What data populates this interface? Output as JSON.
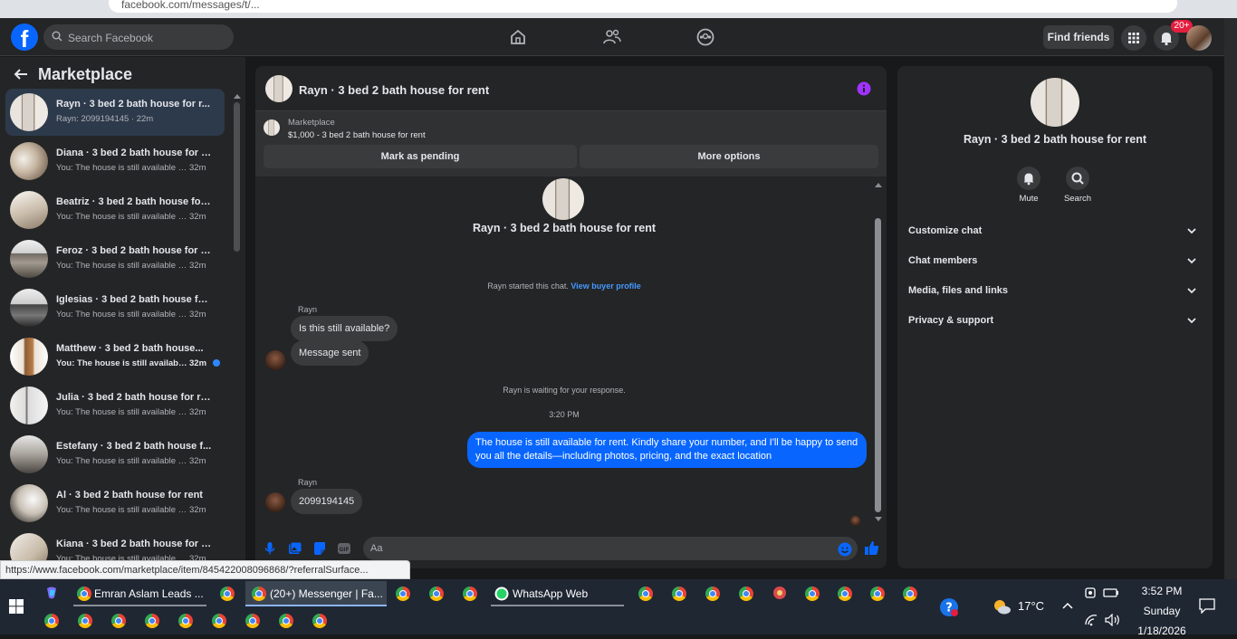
{
  "browser": {
    "url_fragment": "facebook.com/messages/t/..."
  },
  "topnav": {
    "search_placeholder": "Search Facebook",
    "find_friends": "Find friends",
    "notif_badge": "20+"
  },
  "sidebar": {
    "title": "Marketplace",
    "conversations": [
      {
        "name": "Rayn · 3 bed 2 bath house for r...",
        "preview": "Rayn: 2099194145 · 22m",
        "time": "",
        "active": true
      },
      {
        "name": "Diana · 3 bed 2 bath house for r...",
        "preview": "You: The house is still available f...",
        "time": "32m"
      },
      {
        "name": "Beatriz · 3 bed 2 bath house for...",
        "preview": "You: The house is still available f...",
        "time": "32m"
      },
      {
        "name": "Feroz · 3 bed 2 bath house for r...",
        "preview": "You: The house is still available f...",
        "time": "32m"
      },
      {
        "name": "Iglesias · 3 bed 2 bath house fo...",
        "preview": "You: The house is still available f...",
        "time": "32m"
      },
      {
        "name": "Matthew · 3 bed 2 bath house...",
        "preview": "You: The house is still availabl...",
        "time": "32m",
        "unread": true
      },
      {
        "name": "Julia · 3 bed 2 bath house for re...",
        "preview": "You: The house is still available f...",
        "time": "32m"
      },
      {
        "name": "Estefany · 3 bed 2 bath house f...",
        "preview": "You: The house is still available f...",
        "time": "32m"
      },
      {
        "name": "Al · 3 bed 2 bath house for rent",
        "preview": "You: The house is still available f...",
        "time": "32m"
      },
      {
        "name": "Kiana · 3 bed 2 bath house for r...",
        "preview": "You: The house is still available f...",
        "time": "32m"
      }
    ]
  },
  "chat": {
    "title": "Rayn · 3 bed 2 bath house for rent",
    "marketplace_label": "Marketplace",
    "listing": "$1,000 - 3 bed 2 bath house for rent",
    "mark_pending": "Mark as pending",
    "more_options": "More options",
    "thread_title": "Rayn · 3 bed 2 bath house for rent",
    "started_text": "Rayn started this chat.",
    "view_profile": "View buyer profile",
    "sender_name": "Rayn",
    "msg_1": "Is this still available?",
    "msg_2": "Message sent",
    "waiting": "Rayn is waiting for your response.",
    "timestamp": "3:20 PM",
    "outgoing": "The house is still available for rent. Kindly share your number, and I'll be happy to send you all the details—including photos, pricing, and the exact location",
    "sender_name_2": "Rayn",
    "msg_3": "2099194145",
    "composer_placeholder": "Aa"
  },
  "right_panel": {
    "title": "Rayn · 3 bed 2 bath house for rent",
    "mute": "Mute",
    "search": "Search",
    "sections": [
      "Customize chat",
      "Chat members",
      "Media, files and links",
      "Privacy & support"
    ]
  },
  "status_url": "https://www.facebook.com/marketplace/item/845422008096868/?referralSurface...",
  "taskbar": {
    "app_1": "Emran Aslam Leads ...",
    "app_2": "(20+) Messenger | Fa...",
    "app_3": "WhatsApp Web",
    "temperature": "17°C",
    "time": "3:52 PM",
    "day": "Sunday",
    "date": "1/18/2026"
  },
  "colors": {
    "accent": "#0866ff",
    "link": "#4599ff",
    "info": "#a033ff",
    "badge": "#e41e3f"
  }
}
